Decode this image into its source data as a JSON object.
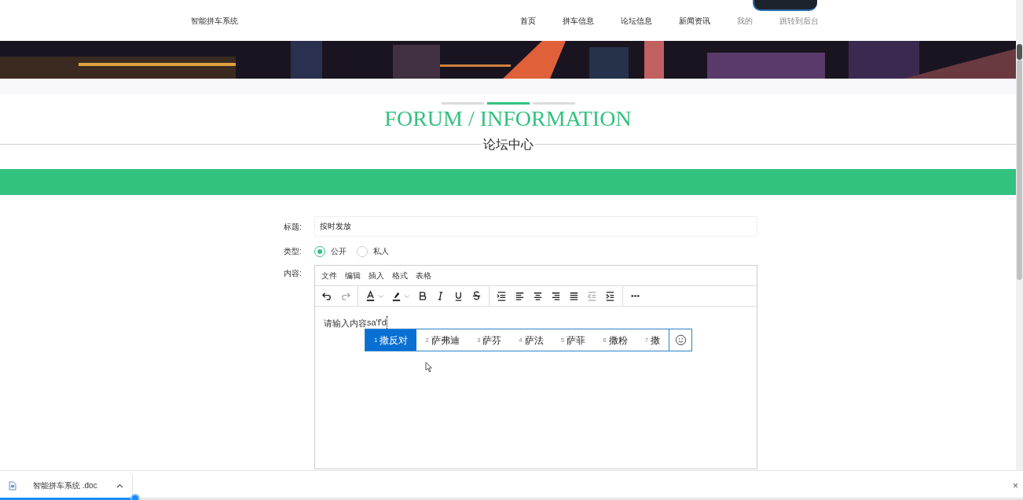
{
  "nav": {
    "brand": "智能拼车系统",
    "items": [
      {
        "label": "首页",
        "selected": false
      },
      {
        "label": "拼车信息",
        "selected": false
      },
      {
        "label": "论坛信息",
        "selected": false
      },
      {
        "label": "新闻资讯",
        "selected": false
      },
      {
        "label": "我的",
        "selected": true
      },
      {
        "label": "跳转到后台",
        "selected": true
      }
    ]
  },
  "heading": {
    "title": "FORUM / INFORMATION",
    "subtitle": "论坛中心"
  },
  "form": {
    "title_label": "标题:",
    "title_value": "按时发放",
    "type_label": "类型:",
    "type_options": [
      {
        "label": "公开",
        "selected": true
      },
      {
        "label": "私人",
        "selected": false
      }
    ],
    "content_label": "内容:",
    "editor": {
      "menus": [
        "文件",
        "编辑",
        "插入",
        "格式",
        "表格"
      ],
      "tools": [
        {
          "kind": "undo",
          "disabled": false
        },
        {
          "kind": "redo",
          "disabled": true
        },
        {
          "kind": "sep"
        },
        {
          "kind": "textcolor"
        },
        {
          "kind": "highlight"
        },
        {
          "kind": "bold"
        },
        {
          "kind": "italic"
        },
        {
          "kind": "underline"
        },
        {
          "kind": "strike"
        },
        {
          "kind": "sep"
        },
        {
          "kind": "lineheight"
        },
        {
          "kind": "alignleft"
        },
        {
          "kind": "aligncenter"
        },
        {
          "kind": "alignright"
        },
        {
          "kind": "justify"
        },
        {
          "kind": "outdent",
          "disabled": true
        },
        {
          "kind": "indent",
          "disabled": false
        },
        {
          "kind": "sep"
        },
        {
          "kind": "more"
        }
      ],
      "text": "请输入内容",
      "composing": "sa'f'd"
    }
  },
  "ime": {
    "candidates": [
      {
        "index": "1",
        "text": "撒反对",
        "selected": true
      },
      {
        "index": "2",
        "text": "萨弗迪",
        "selected": false
      },
      {
        "index": "3",
        "text": "萨芬",
        "selected": false
      },
      {
        "index": "4",
        "text": "萨法",
        "selected": false
      },
      {
        "index": "5",
        "text": "萨菲",
        "selected": false
      },
      {
        "index": "6",
        "text": "撒粉",
        "selected": false
      },
      {
        "index": "7",
        "text": "撒",
        "selected": false
      }
    ]
  },
  "download_bar": {
    "file": "智能拼车系统 .doc",
    "close": "×"
  },
  "playback": {
    "level": 0.132
  }
}
